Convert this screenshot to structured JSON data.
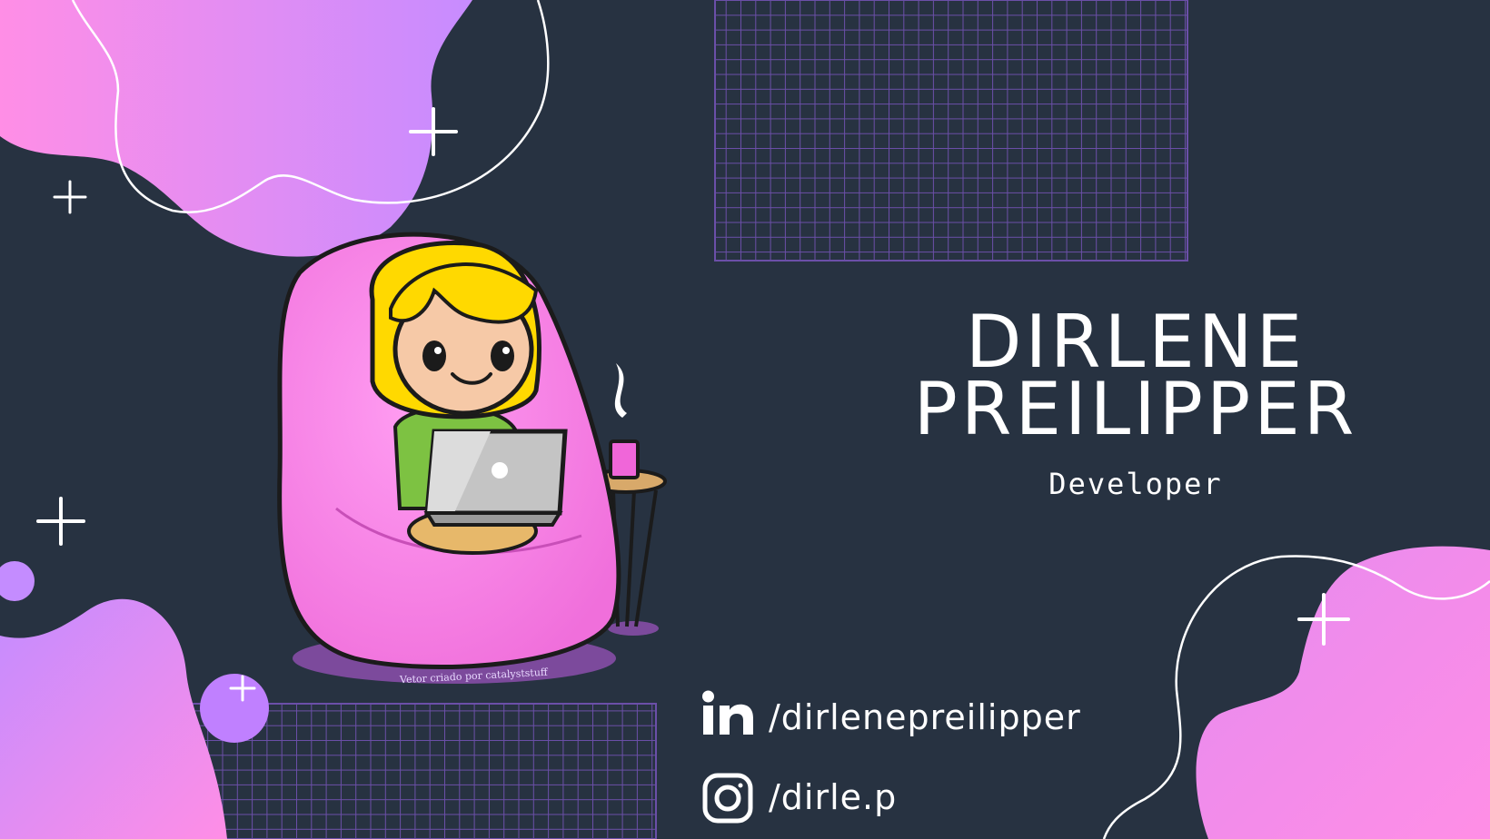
{
  "profile": {
    "name_line1": "DIRLENE",
    "name_line2": "PREILIPPER",
    "role": "Developer"
  },
  "social": {
    "linkedin_handle": "/dirlenepreilipper",
    "linkedin_icon": "linkedin-icon",
    "instagram_handle": "/dirle.p",
    "instagram_icon": "instagram-icon"
  },
  "illustration": {
    "credit": "Vetor criado por catalyststuff"
  },
  "colors": {
    "background": "#273241",
    "blob_start": "#ff8ee6",
    "blob_end": "#b97cff",
    "grid": "#6b4fa8",
    "text": "#ffffff"
  }
}
